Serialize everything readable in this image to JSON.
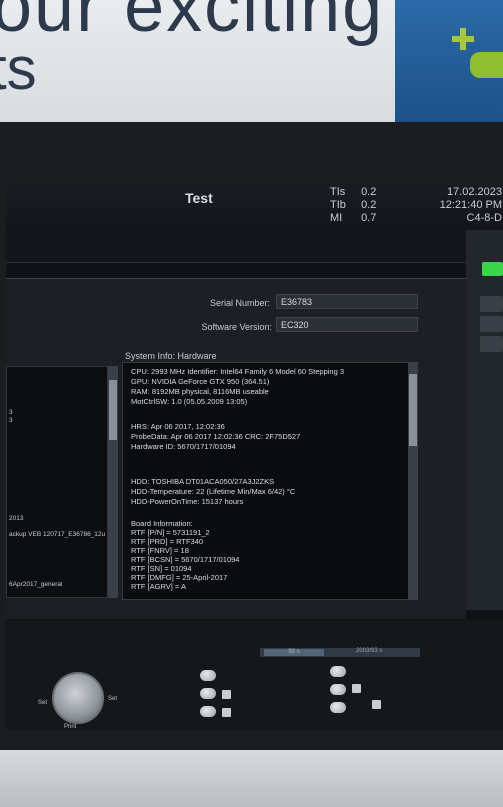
{
  "banner": {
    "line1": "our exciting",
    "line2": "ts"
  },
  "header": {
    "title": "Test",
    "indices": [
      {
        "name": "TIs",
        "value": "0.2"
      },
      {
        "name": "TIb",
        "value": "0.2"
      },
      {
        "name": "MI",
        "value": "0.7"
      }
    ],
    "date": "17.02.2023",
    "time": "12:21:40 PM",
    "probe": "C4-8-D"
  },
  "fields": {
    "serial_label": "Serial Number:",
    "serial_value": "E36783",
    "software_label": "Software Version:",
    "software_value": "EC320"
  },
  "sysinfo": {
    "label": "System Info: Hardware",
    "lines": [
      "CPU: 2993 MHz Identifier: Intel64 Family 6 Model 60 Stepping 3",
      "GPU: NVIDIA GeForce GTX 950 (364.51)",
      "RAM: 8192MB physical, 8116MB useable",
      "MotCtrlSW: 1.0 (05.05.2009 13:05)",
      "",
      "HRS: Apr 06 2017, 12:02:36",
      "ProbeData: Apr 06 2017  12:02:36  CRC: 2F75D527",
      "Hardware ID: 5670/1717/01094",
      "",
      "",
      "HDD: TOSHIBA DT01ACA050/27A3J2ZKS",
      "HDD-Temperature: 22 (Lifetime Min/Max 6/42) °C",
      "HDD-PowerOnTime: 15137 hours",
      "",
      "Board Information:",
      "RTF [P/N] = 5731191_2",
      "RTF [PRD] = RTF340",
      "RTF [FNRV] = 18",
      "RTF [BCSN] = 5670/1717/01094",
      "RTF [SN] = 01094",
      "RTF [DMFG] = 25-April-2017",
      "RTF [AGRV] = A"
    ]
  },
  "left_list": [
    "3",
    "3",
    "2013",
    "ackup VEB 120717_E36786_12u",
    "6Apr2017_general"
  ],
  "controls": {
    "set_left": "Set",
    "set_right": "Set",
    "knob_bottom": "Print",
    "timeline_left": "93 s",
    "timeline_right": "2003/93 s"
  }
}
